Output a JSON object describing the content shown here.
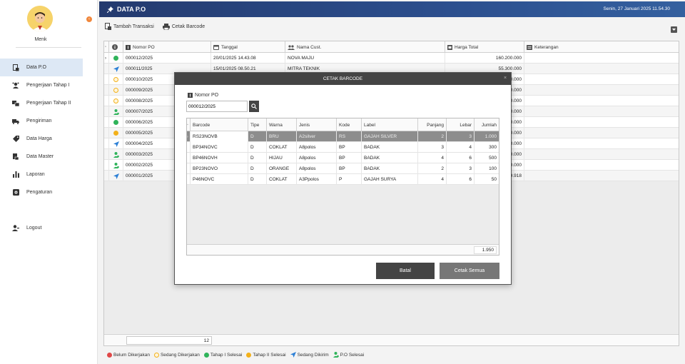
{
  "user": {
    "name": "Menk"
  },
  "sidebar": {
    "items": [
      {
        "label": "Data P.O",
        "icon": "document-icon"
      },
      {
        "label": "Pengerjaan Tahap I",
        "icon": "gear-person-icon"
      },
      {
        "label": "Pengerjaan Tahap II",
        "icon": "gear-person-icon"
      },
      {
        "label": "Pengiriman",
        "icon": "truck-icon"
      },
      {
        "label": "Data Harga",
        "icon": "tag-icon"
      },
      {
        "label": "Data Master",
        "icon": "master-icon"
      },
      {
        "label": "Laporan",
        "icon": "bar-chart-icon"
      },
      {
        "label": "Pengaturan",
        "icon": "settings-icon"
      },
      {
        "label": "Logout",
        "icon": "user-logout-icon"
      }
    ]
  },
  "header": {
    "title": "DATA P.O",
    "datetime": "Senin, 27 Januari 2025  11.54.30"
  },
  "toolbar": {
    "add_label": "Tambah Transaksi",
    "print_label": "Cetak Barcode"
  },
  "grid": {
    "columns": {
      "po": "Nomor PO",
      "tanggal": "Tanggal",
      "cust": "Nama Cust.",
      "harga": "Harga Total",
      "ket": "Keterangan"
    },
    "rows": [
      {
        "status": "green",
        "po": "000012/2025",
        "tanggal": "20/01/2025 14.43.08",
        "cust": "NOVA MAJU",
        "harga": "160.200.000",
        "ket": ""
      },
      {
        "status": "send",
        "po": "000011/2025",
        "tanggal": "15/01/2025 08.50.21",
        "cust": "MITRA TEKNIK",
        "harga": "55.300.000",
        "ket": ""
      },
      {
        "status": "yellow-outline",
        "po": "000010/2025",
        "tanggal": "",
        "cust": "",
        "harga": "0.000",
        "ket": ""
      },
      {
        "status": "yellow-outline",
        "po": "000009/2025",
        "tanggal": "",
        "cust": "",
        "harga": "0.000",
        "ket": ""
      },
      {
        "status": "yellow-outline",
        "po": "000008/2025",
        "tanggal": "",
        "cust": "",
        "harga": "0.000",
        "ket": ""
      },
      {
        "status": "person",
        "po": "000007/2025",
        "tanggal": "",
        "cust": "",
        "harga": "0.000",
        "ket": ""
      },
      {
        "status": "green",
        "po": "000006/2025",
        "tanggal": "",
        "cust": "",
        "harga": "0.000",
        "ket": ""
      },
      {
        "status": "yellow",
        "po": "000005/2025",
        "tanggal": "",
        "cust": "",
        "harga": "0.000",
        "ket": ""
      },
      {
        "status": "send",
        "po": "000004/2025",
        "tanggal": "",
        "cust": "",
        "harga": "0.000",
        "ket": ""
      },
      {
        "status": "person",
        "po": "000003/2025",
        "tanggal": "",
        "cust": "",
        "harga": "0.000",
        "ket": ""
      },
      {
        "status": "person",
        "po": "000002/2025",
        "tanggal": "",
        "cust": "",
        "harga": "0.000",
        "ket": ""
      },
      {
        "status": "send",
        "po": "000001/2025",
        "tanggal": "",
        "cust": "",
        "harga": "9.918",
        "ket": ""
      }
    ],
    "footer_count": "12"
  },
  "legend": [
    {
      "label": "Belum Dikerjakan",
      "color": "#e04848",
      "kind": "dot"
    },
    {
      "label": "Sedang Dikerjakan",
      "color": "#f3b11a",
      "kind": "dot-outline"
    },
    {
      "label": "Tahap I Selesai",
      "color": "#2fb35a",
      "kind": "dot"
    },
    {
      "label": "Tahap II Selesai",
      "color": "#f3b11a",
      "kind": "dot"
    },
    {
      "label": "Sedang Dikirim",
      "color": "#2b7fd6",
      "kind": "send"
    },
    {
      "label": "P.O Selesai",
      "color": "#2fb35a",
      "kind": "person"
    }
  ],
  "modal": {
    "title": "CETAK BARCODE",
    "po_label": "Nomor PO",
    "po_value": "000012/2025",
    "columns": {
      "barcode": "Barcode",
      "tipe": "Tipe",
      "warna": "Warna",
      "jenis": "Jenis",
      "kode": "Kode",
      "label": "Label",
      "panjang": "Panjang",
      "lebar": "Lebar",
      "jumlah": "Jumlah"
    },
    "rows": [
      {
        "barcode": "RS23NOVB",
        "tipe": "D",
        "warna": "BRU",
        "jenis": "A2silver",
        "kode": "RS",
        "label": "GAJAH SILVER",
        "panjang": "2",
        "lebar": "3",
        "jumlah": "1.000"
      },
      {
        "barcode": "BP34NOVC",
        "tipe": "D",
        "warna": "COKLAT",
        "jenis": "A8polos",
        "kode": "BP",
        "label": "BADAK",
        "panjang": "3",
        "lebar": "4",
        "jumlah": "300"
      },
      {
        "barcode": "BP46NOVH",
        "tipe": "D",
        "warna": "HIJAU",
        "jenis": "A8polos",
        "kode": "BP",
        "label": "BADAK",
        "panjang": "4",
        "lebar": "6",
        "jumlah": "500"
      },
      {
        "barcode": "BP23NOVO",
        "tipe": "D",
        "warna": "ORANGE",
        "jenis": "A8polos",
        "kode": "BP",
        "label": "BADAK",
        "panjang": "2",
        "lebar": "3",
        "jumlah": "100"
      },
      {
        "barcode": "P46NOVC",
        "tipe": "D",
        "warna": "COKLAT",
        "jenis": "A3Ppolos",
        "kode": "P",
        "label": "GAJAH SURYA",
        "panjang": "4",
        "lebar": "6",
        "jumlah": "50"
      }
    ],
    "total": "1.950",
    "cancel_label": "Batal",
    "print_all_label": "Cetak Semua"
  }
}
